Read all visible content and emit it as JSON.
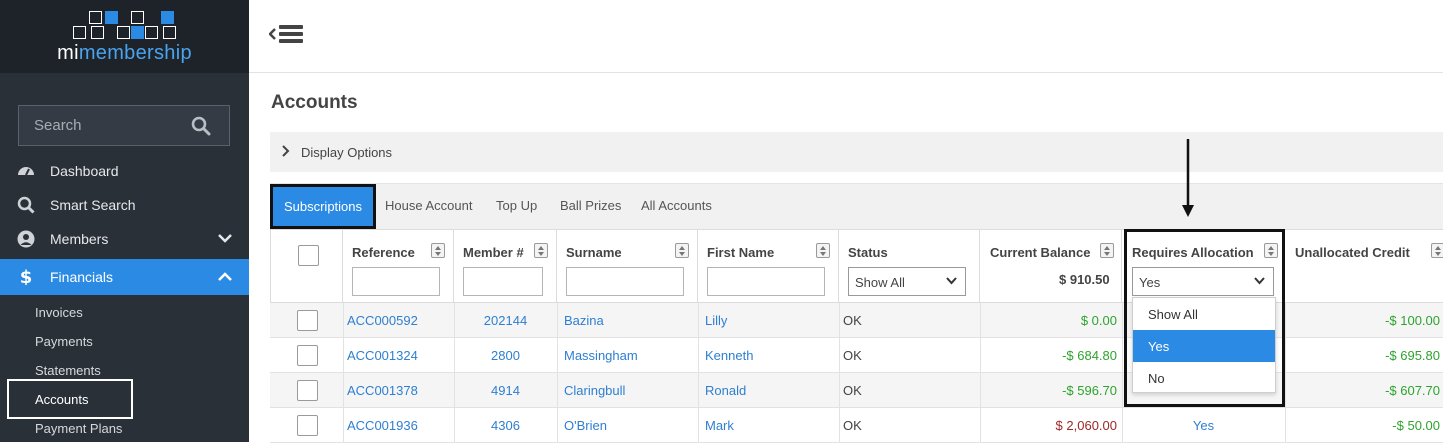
{
  "logo": {
    "prefix": "mi",
    "suffix": "membership"
  },
  "sidebar": {
    "search_placeholder": "Search",
    "items": [
      {
        "label": "Dashboard",
        "icon": "dashboard-icon"
      },
      {
        "label": "Smart Search",
        "icon": "search-icon"
      },
      {
        "label": "Members",
        "icon": "user-icon"
      },
      {
        "label": "Financials",
        "icon": "dollar-icon"
      }
    ],
    "sub_items": [
      "Invoices",
      "Payments",
      "Statements",
      "Accounts",
      "Payment Plans"
    ]
  },
  "page": {
    "title": "Accounts",
    "display_options": "Display Options"
  },
  "tabs": [
    "Subscriptions",
    "House Account",
    "Top Up",
    "Ball Prizes",
    "All Accounts"
  ],
  "table": {
    "headers": [
      "Reference",
      "Member #",
      "Surname",
      "First Name",
      "Status",
      "Current Balance",
      "Requires Allocation",
      "Unallocated Credit"
    ],
    "status_filter": "Show All",
    "allocation_filter": "Yes",
    "balance_total": "$ 910.50",
    "rows": [
      {
        "reference": "ACC000592",
        "member": "202144",
        "surname": "Bazina",
        "first": "Lilly",
        "status": "OK",
        "balance": "$ 0.00",
        "requires": "",
        "credit": "-$ 100.00"
      },
      {
        "reference": "ACC001324",
        "member": "2800",
        "surname": "Massingham",
        "first": "Kenneth",
        "status": "OK",
        "balance": "-$ 684.80",
        "requires": "",
        "credit": "-$ 695.80"
      },
      {
        "reference": "ACC001378",
        "member": "4914",
        "surname": "Claringbull",
        "first": "Ronald",
        "status": "OK",
        "balance": "-$ 596.70",
        "requires": "",
        "credit": "-$ 607.70"
      },
      {
        "reference": "ACC001936",
        "member": "4306",
        "surname": "O'Brien",
        "first": "Mark",
        "status": "OK",
        "balance": "$ 2,060.00",
        "requires": "Yes",
        "credit": "-$ 50.00"
      }
    ]
  },
  "dropdown": {
    "options": [
      "Show All",
      "Yes",
      "No"
    ],
    "selected": "Yes"
  },
  "colors": {
    "accent": "#2b8be4",
    "sidebar": "#2a3038",
    "credit_green": "#2ea32e",
    "debit_red": "#9c2727"
  }
}
